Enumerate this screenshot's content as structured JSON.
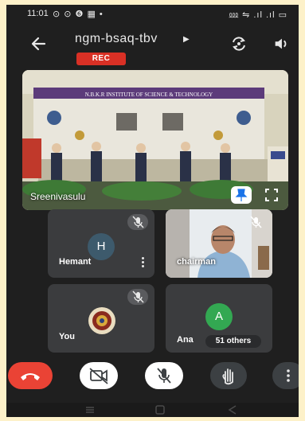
{
  "status_bar": {
    "time": "11:01",
    "notifications": "⊙ ⊙ ❻ ▦ •",
    "system": "⅏ ⇋ .ıl .ıl ▭"
  },
  "header": {
    "meeting_code": "ngm-bsaq-tbv",
    "recording_label": "REC"
  },
  "main_speaker": {
    "name": "Sreenivasulu",
    "banner_text": "N.B.K.R INSTITUTE OF SCIENCE & TECHNOLOGY"
  },
  "participants": [
    {
      "name": "Hemant",
      "initial": "H",
      "avatar_color": "#3d5a6c",
      "muted": true
    },
    {
      "name": "chairman",
      "muted": true
    },
    {
      "name": "You",
      "muted": true
    },
    {
      "name": "Ana",
      "initial": "A",
      "avatar_color": "#33a852",
      "muted": false
    }
  ],
  "others_count_label": "51 others",
  "colors": {
    "end_call": "#ea4335",
    "rec_badge": "#d93025",
    "tile_bg": "#3b3c3e",
    "background": "#1f1f1f"
  }
}
